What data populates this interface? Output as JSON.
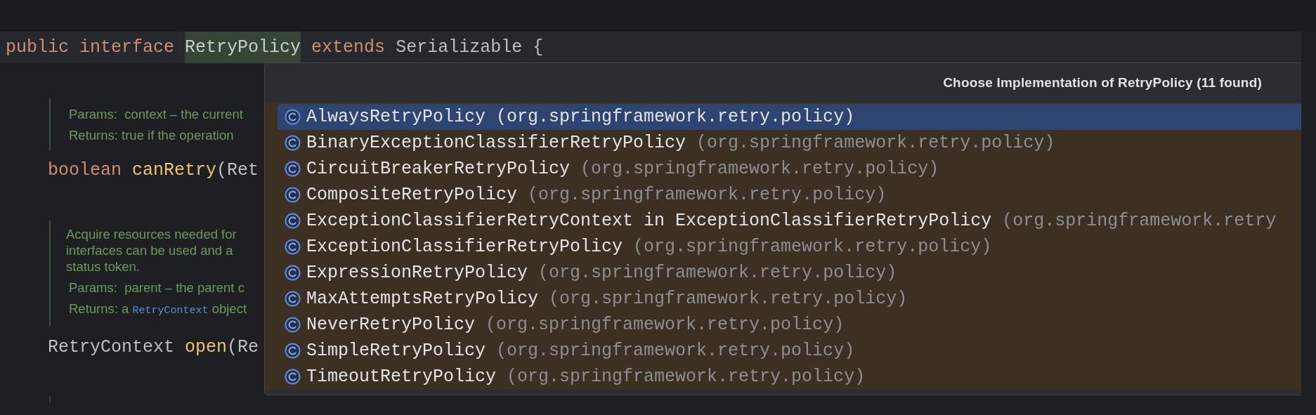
{
  "editor": {
    "lines": [
      {
        "kind": "code",
        "current": true,
        "tokens": [
          {
            "text": "public ",
            "kind": "keyword"
          },
          {
            "text": "interface ",
            "kind": "keyword"
          },
          {
            "text": "RetryPolicy",
            "kind": "usage"
          },
          {
            "text": " extends ",
            "kind": "keyword"
          },
          {
            "text": "Serializable {",
            "kind": "plain"
          }
        ]
      },
      {
        "kind": "doc",
        "tags": [
          {
            "segments": [
              {
                "text": "Params:  context – the current",
                "kind": "text"
              }
            ]
          },
          {
            "segments": [
              {
                "text": "Returns: true if the operation",
                "kind": "text"
              }
            ]
          }
        ]
      },
      {
        "kind": "code",
        "current": false,
        "tokens": [
          {
            "text": "boolean ",
            "kind": "keyword"
          },
          {
            "text": "canRetry",
            "kind": "method"
          },
          {
            "text": "(Ret",
            "kind": "plain"
          }
        ]
      },
      {
        "kind": "doc",
        "paragraph": [
          "Acquire resources needed for",
          "interfaces can be used and a",
          "status token."
        ],
        "tags": [
          {
            "segments": [
              {
                "text": "Params:  parent – the parent c",
                "kind": "text"
              }
            ]
          },
          {
            "segments": [
              {
                "text": "Returns: a ",
                "kind": "text"
              },
              {
                "text": "RetryContext",
                "kind": "link"
              },
              {
                "text": " object",
                "kind": "text"
              }
            ]
          }
        ]
      },
      {
        "kind": "code",
        "current": false,
        "tokens": [
          {
            "text": "RetryContext ",
            "kind": "plain"
          },
          {
            "text": "open",
            "kind": "method"
          },
          {
            "text": "(Re",
            "kind": "plain"
          }
        ]
      }
    ]
  },
  "popup": {
    "title": "Choose Implementation of RetryPolicy (11 found)",
    "items": [
      {
        "name": "AlwaysRetryPolicy",
        "package": "(org.springframework.retry.policy)",
        "selected": true
      },
      {
        "name": "BinaryExceptionClassifierRetryPolicy",
        "package": "(org.springframework.retry.policy)",
        "selected": false
      },
      {
        "name": "CircuitBreakerRetryPolicy",
        "package": "(org.springframework.retry.policy)",
        "selected": false
      },
      {
        "name": "CompositeRetryPolicy",
        "package": "(org.springframework.retry.policy)",
        "selected": false
      },
      {
        "name": "ExceptionClassifierRetryContext in ExceptionClassifierRetryPolicy",
        "package": "(org.springframework.retry",
        "selected": false
      },
      {
        "name": "ExceptionClassifierRetryPolicy",
        "package": "(org.springframework.retry.policy)",
        "selected": false
      },
      {
        "name": "ExpressionRetryPolicy",
        "package": "(org.springframework.retry.policy)",
        "selected": false
      },
      {
        "name": "MaxAttemptsRetryPolicy",
        "package": "(org.springframework.retry.policy)",
        "selected": false
      },
      {
        "name": "NeverRetryPolicy",
        "package": "(org.springframework.retry.policy)",
        "selected": false
      },
      {
        "name": "SimpleRetryPolicy",
        "package": "(org.springframework.retry.policy)",
        "selected": false
      },
      {
        "name": "TimeoutRetryPolicy",
        "package": "(org.springframework.retry.policy)",
        "selected": false
      }
    ]
  }
}
